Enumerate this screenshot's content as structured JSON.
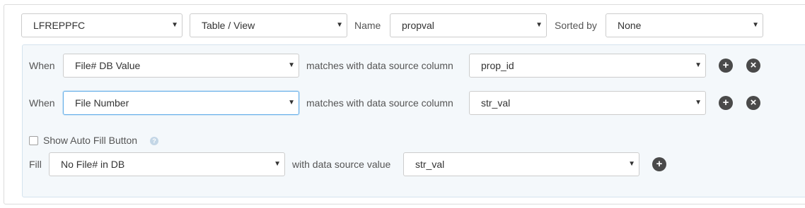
{
  "header": {
    "library_select": "LFREPPFC",
    "type_select": "Table / View",
    "name_label": "Name",
    "name_select": "propval",
    "sorted_label": "Sorted by",
    "sorted_select": "None"
  },
  "rules": [
    {
      "when_label": "When",
      "field": "File# DB Value",
      "match_text": "matches with data source column",
      "column": "prop_id"
    },
    {
      "when_label": "When",
      "field": "File Number",
      "match_text": "matches with data source column",
      "column": "str_val"
    }
  ],
  "auto_fill": {
    "checkbox_label": "Show Auto Fill Button",
    "checked": false,
    "help_glyph": "?"
  },
  "fill": {
    "fill_label": "Fill",
    "field": "No File# in DB",
    "with_text": "with data source value",
    "value": "str_val"
  },
  "icons": {
    "add": "+",
    "remove": "×",
    "caret": "▼"
  },
  "colors": {
    "panel_bg": "#f4f8fb",
    "focus_border": "#66afe9",
    "icon_button": "#4a4a4a"
  }
}
